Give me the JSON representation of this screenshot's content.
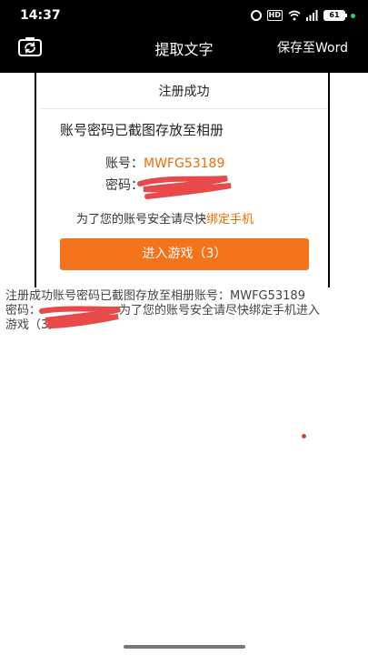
{
  "status_bar": {
    "time": "14:37",
    "hd": "HD",
    "battery": "61"
  },
  "app_bar": {
    "title": "提取文字",
    "save_label": "保存至Word"
  },
  "dialog": {
    "title": "注册成功",
    "heading": "账号密码已截图存放至相册",
    "account_label": "账号：",
    "account_value": "MWFG53189",
    "password_label": "密码：",
    "notice_prefix": "为了您的账号安全请尽快",
    "notice_link": "绑定手机",
    "enter_button": "进入游戏（3）"
  },
  "extracted_text": {
    "line1": "注册成功账号密码已截图存放至相册账号：MWFG53189",
    "line2_prefix": "密码：",
    "line2_suffix": "为了您的账号安全请尽快绑定手机进入",
    "line3": "游戏（3）"
  },
  "colors": {
    "accent": "#f5731b",
    "link": "#f06c00",
    "scribble": "#e84a4a"
  }
}
